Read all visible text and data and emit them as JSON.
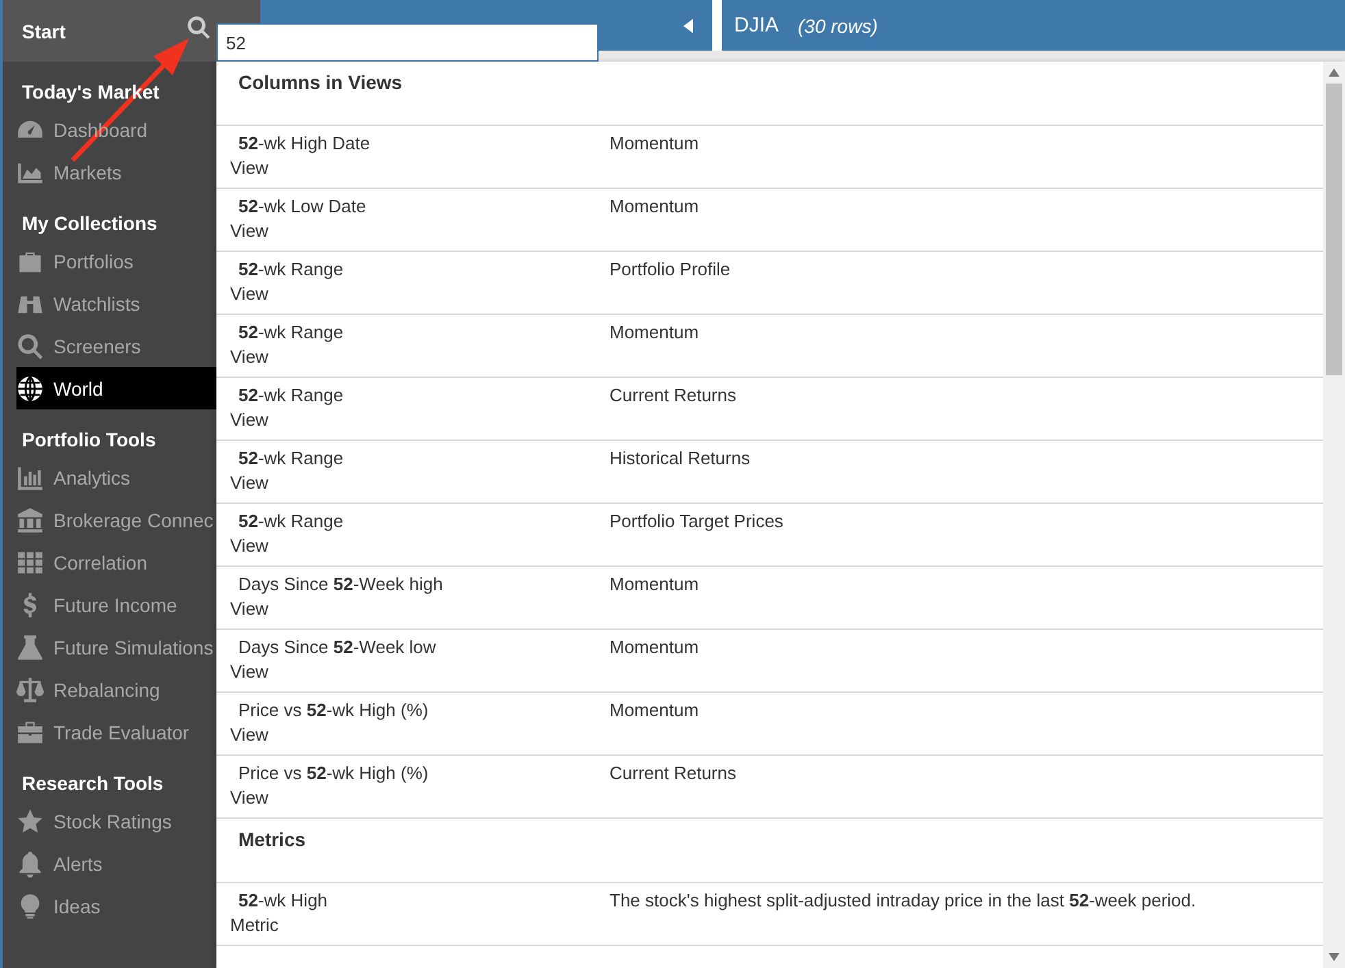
{
  "sidebar": {
    "start_label": "Start",
    "sections": [
      {
        "title": "Today's Market",
        "items": [
          {
            "label": "Dashboard",
            "selected": false
          },
          {
            "label": "Markets",
            "selected": false
          }
        ]
      },
      {
        "title": "My Collections",
        "items": [
          {
            "label": "Portfolios",
            "selected": false
          },
          {
            "label": "Watchlists",
            "selected": false
          },
          {
            "label": "Screeners",
            "selected": false
          },
          {
            "label": "World",
            "selected": true
          }
        ]
      },
      {
        "title": "Portfolio Tools",
        "items": [
          {
            "label": "Analytics",
            "selected": false
          },
          {
            "label": "Brokerage Connec",
            "selected": false
          },
          {
            "label": "Correlation",
            "selected": false
          },
          {
            "label": "Future Income",
            "selected": false
          },
          {
            "label": "Future Simulations",
            "selected": false
          },
          {
            "label": "Rebalancing",
            "selected": false
          },
          {
            "label": "Trade Evaluator",
            "selected": false
          }
        ]
      },
      {
        "title": "Research Tools",
        "items": [
          {
            "label": "Stock Ratings",
            "selected": false
          },
          {
            "label": "Alerts",
            "selected": false
          },
          {
            "label": "Ideas",
            "selected": false
          }
        ]
      }
    ]
  },
  "search": {
    "value": "52"
  },
  "header": {
    "title": "DJIA",
    "subtitle": "(30 rows)"
  },
  "results": [
    {
      "title": "Columns in Views",
      "rows": [
        {
          "name": "**52**-wk High Date",
          "type": "View",
          "detail": "Momentum"
        },
        {
          "name": "**52**-wk Low Date",
          "type": "View",
          "detail": "Momentum"
        },
        {
          "name": "**52**-wk Range",
          "type": "View",
          "detail": "Portfolio Profile"
        },
        {
          "name": "**52**-wk Range",
          "type": "View",
          "detail": "Momentum"
        },
        {
          "name": "**52**-wk Range",
          "type": "View",
          "detail": "Current Returns"
        },
        {
          "name": "**52**-wk Range",
          "type": "View",
          "detail": "Historical Returns"
        },
        {
          "name": "**52**-wk Range",
          "type": "View",
          "detail": "Portfolio Target Prices"
        },
        {
          "name": "Days Since **52**-Week high",
          "type": "View",
          "detail": "Momentum"
        },
        {
          "name": "Days Since **52**-Week low",
          "type": "View",
          "detail": "Momentum"
        },
        {
          "name": "Price vs **52**-wk High (%)",
          "type": "View",
          "detail": "Momentum"
        },
        {
          "name": "Price vs **52**-wk High (%)",
          "type": "View",
          "detail": "Current Returns"
        }
      ]
    },
    {
      "title": "Metrics",
      "rows": [
        {
          "name": "**52**-wk High",
          "type": "Metric",
          "detail": "The stock's highest split-adjusted intraday price in the last **52**-week period."
        }
      ]
    }
  ]
}
